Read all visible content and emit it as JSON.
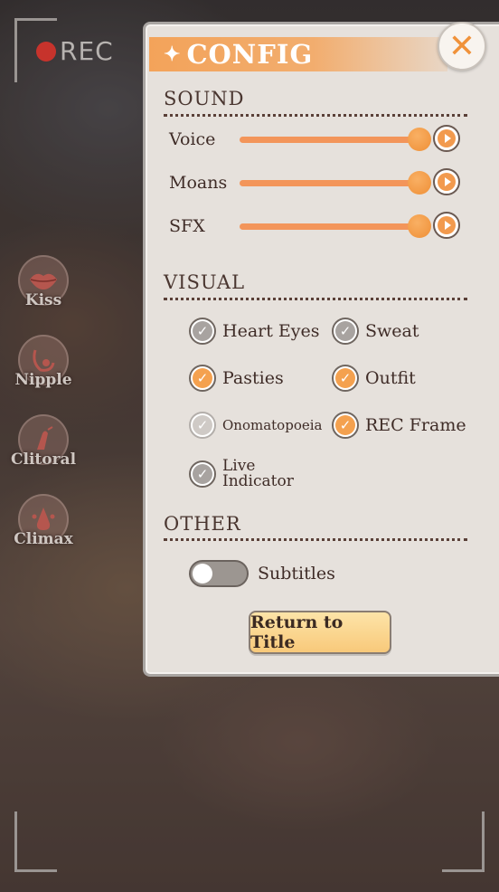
{
  "rec_overlay": {
    "label": "REC"
  },
  "side_actions": [
    {
      "label": "Kiss",
      "icon": "lips-icon"
    },
    {
      "label": "Nipple",
      "icon": "nipple-icon"
    },
    {
      "label": "Clitoral",
      "icon": "finger-icon"
    },
    {
      "label": "Climax",
      "icon": "splash-icon"
    }
  ],
  "config": {
    "title": "CONFIG",
    "sound": {
      "heading": "SOUND",
      "sliders": [
        {
          "label": "Voice",
          "level": 1.0
        },
        {
          "label": "Moans",
          "level": 1.0
        },
        {
          "label": "SFX",
          "level": 1.0
        }
      ]
    },
    "visual": {
      "heading": "VISUAL",
      "options": [
        {
          "label": "Heart Eyes",
          "checked": false
        },
        {
          "label": "Sweat",
          "checked": false
        },
        {
          "label": "Pasties",
          "checked": true
        },
        {
          "label": "Outfit",
          "checked": true
        },
        {
          "label": "Onomatopoeia",
          "checked": false,
          "disabled": true
        },
        {
          "label": "REC Frame",
          "checked": true
        },
        {
          "label_line1": "Live",
          "label_line2": "Indicator",
          "checked": false
        }
      ]
    },
    "other": {
      "heading": "OTHER",
      "subtitles": {
        "label": "Subtitles",
        "on": false
      }
    },
    "return_button": "Return to Title"
  },
  "colors": {
    "accent": "#f4a14f",
    "title_bar": "#f3a35a",
    "panel_bg": "#e6e1dc",
    "text": "#3f2c27",
    "rec_dot": "#c7332c"
  }
}
